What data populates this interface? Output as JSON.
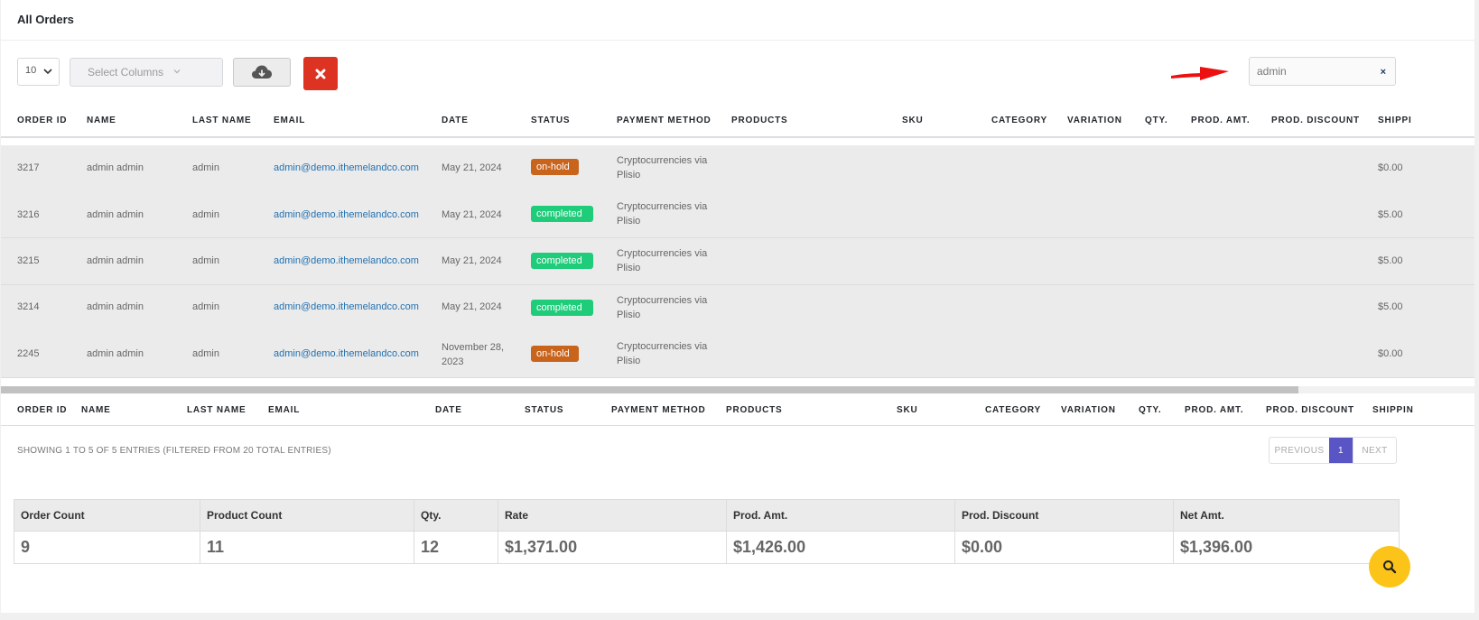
{
  "page": {
    "title": "All Orders"
  },
  "toolbar": {
    "length_value": "10",
    "columns_placeholder": "Select Columns",
    "search_value": "admin",
    "search_clear": "×"
  },
  "table": {
    "columns": [
      "ORDER ID",
      "NAME",
      "LAST NAME",
      "EMAIL",
      "DATE",
      "STATUS",
      "PAYMENT METHOD",
      "PRODUCTS",
      "SKU",
      "CATEGORY",
      "VARIATION",
      "QTY.",
      "PROD. AMT.",
      "PROD. DISCOUNT",
      "SHIPPI"
    ],
    "footer_columns": [
      "ORDER ID",
      "NAME",
      "LAST NAME",
      "EMAIL",
      "DATE",
      "STATUS",
      "PAYMENT METHOD",
      "PRODUCTS",
      "SKU",
      "CATEGORY",
      "VARIATION",
      "QTY.",
      "PROD. AMT.",
      "PROD. DISCOUNT",
      "SHIPPIN"
    ],
    "rows": [
      {
        "order_id": "3217",
        "name": "admin admin",
        "last_name": "admin",
        "email": "admin@demo.ithemelandco.com",
        "date_l1": "May 21, 2024",
        "date_l2": "",
        "status": "on-hold",
        "payment_l1": "Cryptocurrencies via",
        "payment_l2": "Plisio",
        "shipping": "$0.00"
      },
      {
        "order_id": "3216",
        "name": "admin admin",
        "last_name": "admin",
        "email": "admin@demo.ithemelandco.com",
        "date_l1": "May 21, 2024",
        "date_l2": "",
        "status": "completed",
        "payment_l1": "Cryptocurrencies via",
        "payment_l2": "Plisio",
        "shipping": "$5.00"
      },
      {
        "order_id": "3215",
        "name": "admin admin",
        "last_name": "admin",
        "email": "admin@demo.ithemelandco.com",
        "date_l1": "May 21, 2024",
        "date_l2": "",
        "status": "completed",
        "payment_l1": "Cryptocurrencies via",
        "payment_l2": "Plisio",
        "shipping": "$5.00"
      },
      {
        "order_id": "3214",
        "name": "admin admin",
        "last_name": "admin",
        "email": "admin@demo.ithemelandco.com",
        "date_l1": "May 21, 2024",
        "date_l2": "",
        "status": "completed",
        "payment_l1": "Cryptocurrencies via",
        "payment_l2": "Plisio",
        "shipping": "$5.00"
      },
      {
        "order_id": "2245",
        "name": "admin admin",
        "last_name": "admin",
        "email": "admin@demo.ithemelandco.com",
        "date_l1": "November 28,",
        "date_l2": "2023",
        "status": "on-hold",
        "payment_l1": "Cryptocurrencies via",
        "payment_l2": "Plisio",
        "shipping": "$0.00"
      }
    ],
    "info": "SHOWING 1 TO 5 OF 5 ENTRIES (FILTERED FROM 20 TOTAL ENTRIES)"
  },
  "pagination": {
    "previous": "PREVIOUS",
    "current": "1",
    "next": "NEXT"
  },
  "summary": {
    "headers": [
      "Order Count",
      "Product Count",
      "Qty.",
      "Rate",
      "Prod. Amt.",
      "Prod. Discount",
      "Net Amt."
    ],
    "values": [
      "9",
      "11",
      "12",
      "$1,371.00",
      "$1,426.00",
      "$0.00",
      "$1,396.00"
    ]
  },
  "icons": {
    "download": "cloud-download-icon",
    "clear": "close-icon",
    "search_fab": "search-icon",
    "arrow": "red-arrow-pointer"
  },
  "colors": {
    "status_on_hold": "#c9641c",
    "status_completed": "#1fcc7a",
    "link": "#2271b1",
    "clear_button": "#dc3323",
    "pagination_active": "#5a55c4",
    "fab": "#fcc419"
  }
}
